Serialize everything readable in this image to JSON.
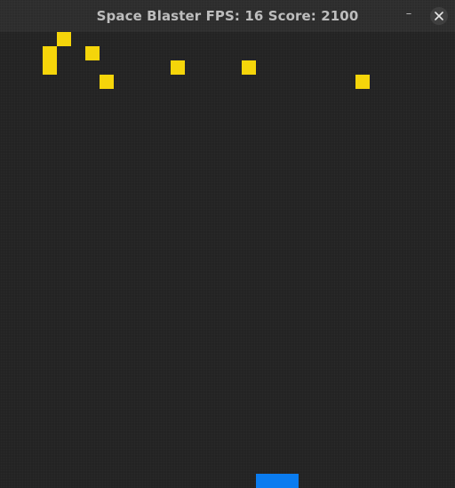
{
  "window": {
    "title": "Space Blaster FPS: 16 Score: 2100",
    "minimize_label": "–"
  },
  "game": {
    "background_color": "#232323",
    "enemy_color": "#f5d50a",
    "player_color": "#0a7cf0",
    "enemy_count": 8
  }
}
